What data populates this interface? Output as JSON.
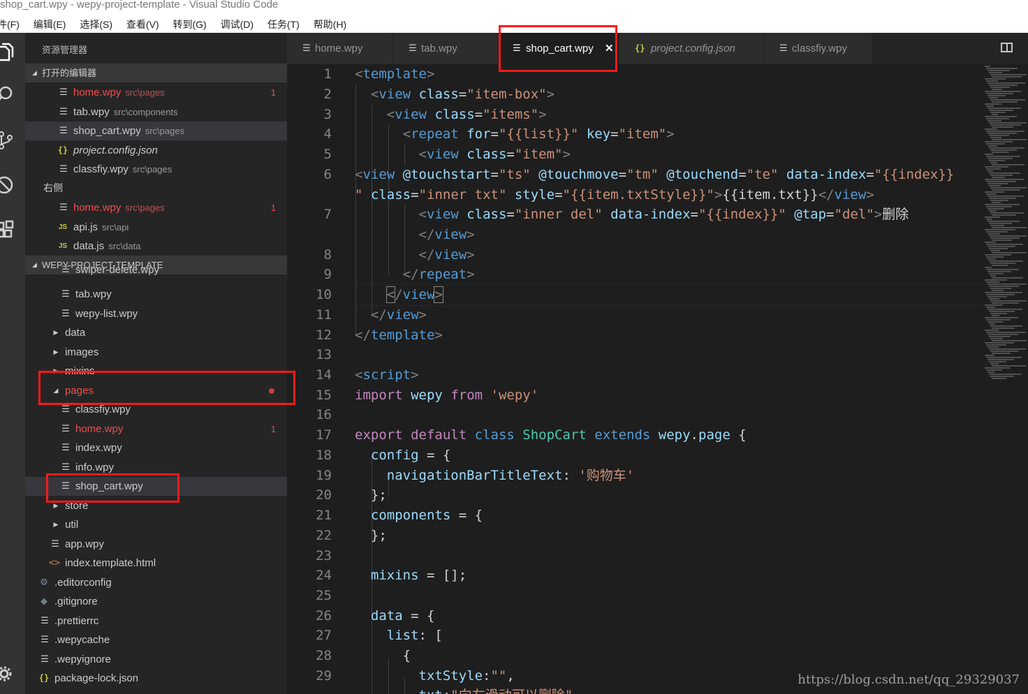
{
  "window": {
    "title": "shop_cart.wpy - wepy-project-template - Visual Studio Code"
  },
  "menu": [
    "件(F)",
    "编辑(E)",
    "选择(S)",
    "查看(V)",
    "转到(G)",
    "调试(D)",
    "任务(T)",
    "帮助(H)"
  ],
  "sidebar": {
    "title": "资源管理器",
    "open_editors": {
      "header": "打开的编辑器",
      "group1": [
        {
          "name": "home.wpy",
          "path": "src\\pages",
          "badge": "1"
        },
        {
          "name": "tab.wpy",
          "path": "src\\components",
          "badge": ""
        },
        {
          "name": "shop_cart.wpy",
          "path": "src\\pages",
          "badge": ""
        },
        {
          "name": "project.config.json",
          "path": "",
          "badge": ""
        },
        {
          "name": "classfiy.wpy",
          "path": "src\\pages",
          "badge": ""
        }
      ],
      "group2_label": "右侧",
      "group2": [
        {
          "name": "home.wpy",
          "path": "src\\pages",
          "badge": "1"
        },
        {
          "name": "api.js",
          "path": "src\\api",
          "badge": ""
        },
        {
          "name": "data.js",
          "path": "src\\data",
          "badge": ""
        }
      ]
    },
    "project": {
      "header": "WEPY-PROJECT-TEMPLATE",
      "items": [
        "swiper-delete.wpy",
        "tab.wpy",
        "wepy-list.wpy",
        "data",
        "images",
        "mixins",
        "pages",
        "classfiy.wpy",
        "home.wpy",
        "index.wpy",
        "info.wpy",
        "shop_cart.wpy",
        "store",
        "util",
        "app.wpy",
        "index.template.html",
        ".editorconfig",
        ".gitignore",
        ".prettierrc",
        ".wepycache",
        ".wepyignore",
        "package-lock.json"
      ],
      "home_badge": "1"
    }
  },
  "tabs": [
    {
      "label": "home.wpy"
    },
    {
      "label": "tab.wpy"
    },
    {
      "label": "shop_cart.wpy",
      "close": "✕"
    },
    {
      "label": "project.config.json"
    },
    {
      "label": "classfiy.wpy"
    }
  ],
  "editor": {
    "line_numbers": [
      "1",
      "2",
      "3",
      "4",
      "5",
      "6",
      "7",
      "8",
      "9",
      "10",
      "11",
      "12",
      "13",
      "14",
      "15",
      "16",
      "17",
      "18",
      "19",
      "20",
      "21",
      "22",
      "23",
      "24",
      "25",
      "26",
      "27",
      "28",
      "29"
    ]
  },
  "watermark": "https://blog.csdn.net/qq_29329037",
  "colors": {
    "highlight": "#ff1a1a",
    "accent_error": "#f14c4c",
    "keyword": "#c586c0",
    "tag": "#569cd6",
    "string": "#ce9178"
  }
}
